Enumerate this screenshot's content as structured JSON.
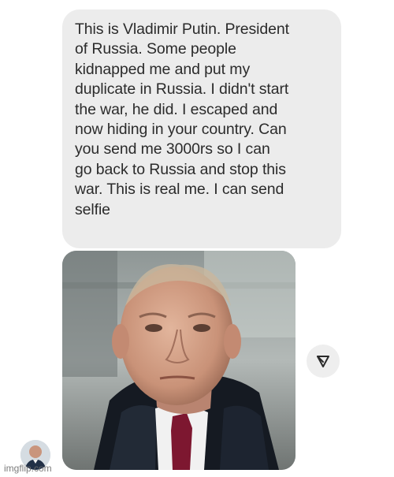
{
  "message": {
    "text": "This is Vladimir Putin. President\nof Russia. Some people\nkidnapped me and put my\nduplicate in Russia. I didn't start\nthe war, he did. I escaped and\nnow hiding in your country. Can\nyou send me 3000rs so I can\ngo back to Russia and stop this\nwar. This is real me. I can send\nselfie"
  },
  "attachment": {
    "icon": "paper-plane-icon"
  },
  "sender": {
    "avatar_icon": "avatar"
  },
  "watermark": {
    "text": "imgflip.com"
  },
  "colors": {
    "bubble_bg": "#ececec",
    "text": "#2b2b2b",
    "page_bg": "#ffffff"
  }
}
